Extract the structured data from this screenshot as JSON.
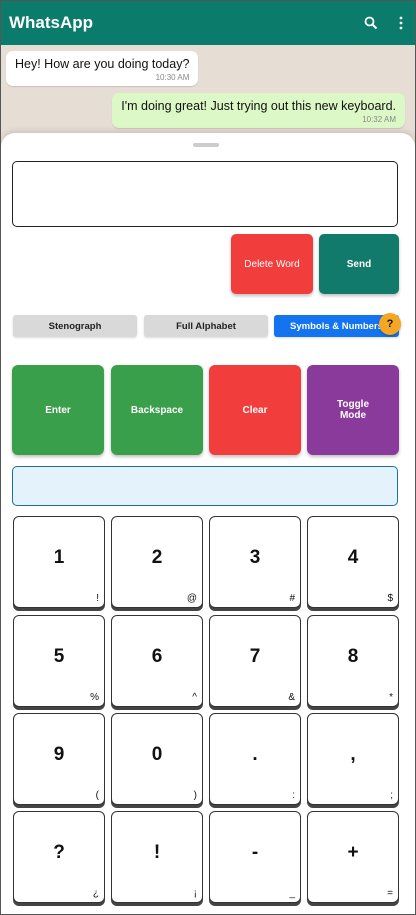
{
  "app": {
    "title": "WhatsApp"
  },
  "messages": [
    {
      "text": "Hey! How are you doing today?",
      "time": "10:30 AM",
      "direction": "incoming"
    },
    {
      "text": "I'm doing great! Just trying out this new keyboard.",
      "time": "10:32 AM",
      "direction": "outgoing"
    }
  ],
  "keyboard": {
    "delete_word": "Delete Word",
    "send": "Send",
    "tabs": [
      "Stenograph",
      "Full Alphabet",
      "Symbols & Numbers"
    ],
    "active_tab": "Symbols & Numbers",
    "help": "?",
    "actions": [
      "Enter",
      "Backspace",
      "Clear",
      "Toggle Mode"
    ],
    "keys": [
      {
        "main": "1",
        "sub": "!"
      },
      {
        "main": "2",
        "sub": "@"
      },
      {
        "main": "3",
        "sub": "#"
      },
      {
        "main": "4",
        "sub": "$"
      },
      {
        "main": "5",
        "sub": "%"
      },
      {
        "main": "6",
        "sub": "^"
      },
      {
        "main": "7",
        "sub": "&"
      },
      {
        "main": "8",
        "sub": "*"
      },
      {
        "main": "9",
        "sub": "("
      },
      {
        "main": "0",
        "sub": ")"
      },
      {
        "main": ".",
        "sub": ":"
      },
      {
        "main": ",",
        "sub": ";"
      },
      {
        "main": "?",
        "sub": "¿"
      },
      {
        "main": "!",
        "sub": "¡"
      },
      {
        "main": "-",
        "sub": "_"
      },
      {
        "main": "+",
        "sub": "="
      }
    ]
  },
  "colors": {
    "header": "#0b7c6c",
    "send": "#117a6a",
    "delete": "#f23d3d",
    "active_tab": "#1474f0",
    "enter": "#3a9f4b",
    "clear": "#f23d3d",
    "toggle": "#8a3a9a",
    "help": "#f5a623"
  },
  "icons": {
    "search": "search-icon",
    "menu": "more-vertical-icon"
  }
}
